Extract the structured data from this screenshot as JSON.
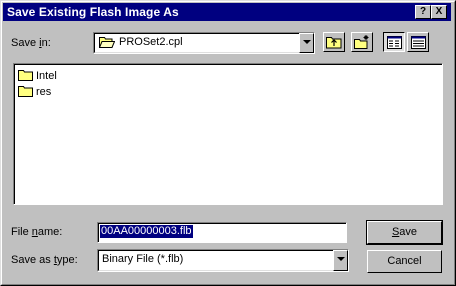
{
  "window": {
    "title": "Save Existing Flash Image As",
    "help_glyph": "?",
    "close_glyph": "X"
  },
  "save_in": {
    "label_pre": "Save ",
    "label_key": "i",
    "label_post": "n:",
    "value": "PROSet2.cpl",
    "icon": "folder-open-icon"
  },
  "toolbar": {
    "buttons": [
      "up-one-level-icon",
      "create-new-folder-icon",
      "list-view-icon",
      "details-view-icon"
    ]
  },
  "files": [
    {
      "name": "Intel",
      "icon": "folder-icon"
    },
    {
      "name": "res",
      "icon": "folder-icon"
    }
  ],
  "file_name": {
    "label_pre": "File ",
    "label_key": "n",
    "label_post": "ame:",
    "value": "00AA00000003.flb"
  },
  "save_as_type": {
    "label_pre": "Save as ",
    "label_key": "t",
    "label_post": "ype:",
    "value": "Binary File (*.flb)"
  },
  "buttons": {
    "save_key": "S",
    "save_rest": "ave",
    "cancel": "Cancel"
  }
}
